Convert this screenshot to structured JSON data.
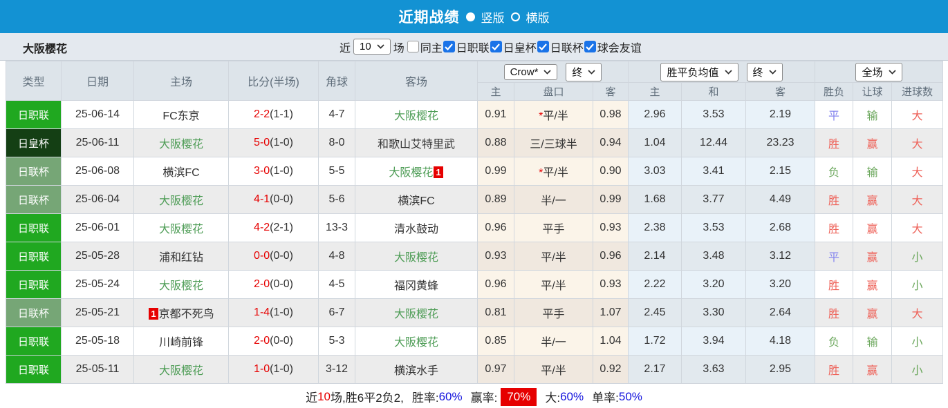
{
  "colors": {
    "titlebar_bg": "#1392d3",
    "league_colors": {
      "日职联": "#20a820",
      "日皇杯": "#143f14",
      "日联杯": "#76a676"
    },
    "self_team_green": "#4d9c55",
    "score_red": "#e60000",
    "checkbox_blue": "#1a73e8",
    "result_colors": {
      "red": "#ee6259",
      "blue": "#8585ee",
      "green": "#6ba75c"
    },
    "summary_value_blue": "#1414dd",
    "summary_badge_bg": "#e60000"
  },
  "titlebar": {
    "title": "近期战绩",
    "radio_options": [
      {
        "label": "竖版",
        "selected": true
      },
      {
        "label": "横版",
        "selected": false
      }
    ]
  },
  "filterbar": {
    "team": "大阪樱花",
    "near_label": "近",
    "count_select": "10",
    "games_label": "场",
    "checkboxes": [
      {
        "label": "同主",
        "checked": false
      },
      {
        "label": "日职联",
        "checked": true
      },
      {
        "label": "日皇杯",
        "checked": true
      },
      {
        "label": "日联杯",
        "checked": true
      },
      {
        "label": "球会友谊",
        "checked": true
      }
    ]
  },
  "table": {
    "static_headers": [
      "类型",
      "日期",
      "主场",
      "比分(半场)",
      "角球",
      "客场"
    ],
    "selects": {
      "bookmaker": "Crow*",
      "ah_time": "终",
      "odds_type": "胜平负均值",
      "eu_time": "终",
      "scope": "全场"
    },
    "sub_headers": [
      "主",
      "盘口",
      "客",
      "主",
      "和",
      "客",
      "胜负",
      "让球",
      "进球数"
    ],
    "rows": [
      {
        "type": "日职联",
        "date": "25-06-14",
        "home": {
          "name": "FC东京",
          "self": false
        },
        "score": "2-2",
        "half": "(1-1)",
        "corners": "4-7",
        "away": {
          "name": "大阪樱花",
          "self": true
        },
        "ah": [
          "0.91",
          "*平/半",
          "0.98"
        ],
        "eu": [
          "2.96",
          "3.53",
          "2.19"
        ],
        "res": [
          [
            "平",
            "blue"
          ],
          [
            "输",
            "green"
          ],
          [
            "大",
            "red"
          ]
        ]
      },
      {
        "type": "日皇杯",
        "date": "25-06-11",
        "home": {
          "name": "大阪樱花",
          "self": true
        },
        "score": "5-0",
        "half": "(1-0)",
        "corners": "8-0",
        "away": {
          "name": "和歌山艾特里武",
          "self": false
        },
        "ah": [
          "0.88",
          "三/三球半",
          "0.94"
        ],
        "eu": [
          "1.04",
          "12.44",
          "23.23"
        ],
        "res": [
          [
            "胜",
            "red"
          ],
          [
            "赢",
            "red"
          ],
          [
            "大",
            "red"
          ]
        ]
      },
      {
        "type": "日联杯",
        "date": "25-06-08",
        "home": {
          "name": "横滨FC",
          "self": false
        },
        "score": "3-0",
        "half": "(1-0)",
        "corners": "5-5",
        "away": {
          "name": "大阪樱花",
          "self": true,
          "badge": "1",
          "badge_pos": "after"
        },
        "ah": [
          "0.99",
          "*平/半",
          "0.90"
        ],
        "eu": [
          "3.03",
          "3.41",
          "2.15"
        ],
        "res": [
          [
            "负",
            "green"
          ],
          [
            "输",
            "green"
          ],
          [
            "大",
            "red"
          ]
        ]
      },
      {
        "type": "日联杯",
        "date": "25-06-04",
        "home": {
          "name": "大阪樱花",
          "self": true
        },
        "score": "4-1",
        "half": "(0-0)",
        "corners": "5-6",
        "away": {
          "name": "横滨FC",
          "self": false
        },
        "ah": [
          "0.89",
          "半/一",
          "0.99"
        ],
        "eu": [
          "1.68",
          "3.77",
          "4.49"
        ],
        "res": [
          [
            "胜",
            "red"
          ],
          [
            "赢",
            "red"
          ],
          [
            "大",
            "red"
          ]
        ]
      },
      {
        "type": "日职联",
        "date": "25-06-01",
        "home": {
          "name": "大阪樱花",
          "self": true
        },
        "score": "4-2",
        "half": "(2-1)",
        "corners": "13-3",
        "away": {
          "name": "清水鼓动",
          "self": false
        },
        "ah": [
          "0.96",
          "平手",
          "0.93"
        ],
        "eu": [
          "2.38",
          "3.53",
          "2.68"
        ],
        "res": [
          [
            "胜",
            "red"
          ],
          [
            "赢",
            "red"
          ],
          [
            "大",
            "red"
          ]
        ]
      },
      {
        "type": "日职联",
        "date": "25-05-28",
        "home": {
          "name": "浦和红钻",
          "self": false
        },
        "score": "0-0",
        "half": "(0-0)",
        "corners": "4-8",
        "away": {
          "name": "大阪樱花",
          "self": true
        },
        "ah": [
          "0.93",
          "平/半",
          "0.96"
        ],
        "eu": [
          "2.14",
          "3.48",
          "3.12"
        ],
        "res": [
          [
            "平",
            "blue"
          ],
          [
            "赢",
            "red"
          ],
          [
            "小",
            "green"
          ]
        ]
      },
      {
        "type": "日职联",
        "date": "25-05-24",
        "home": {
          "name": "大阪樱花",
          "self": true
        },
        "score": "2-0",
        "half": "(0-0)",
        "corners": "4-5",
        "away": {
          "name": "福冈黄蜂",
          "self": false
        },
        "ah": [
          "0.96",
          "平/半",
          "0.93"
        ],
        "eu": [
          "2.22",
          "3.20",
          "3.20"
        ],
        "res": [
          [
            "胜",
            "red"
          ],
          [
            "赢",
            "red"
          ],
          [
            "小",
            "green"
          ]
        ]
      },
      {
        "type": "日联杯",
        "date": "25-05-21",
        "home": {
          "name": "京都不死鸟",
          "self": false,
          "badge": "1",
          "badge_pos": "before"
        },
        "score": "1-4",
        "half": "(1-0)",
        "corners": "6-7",
        "away": {
          "name": "大阪樱花",
          "self": true
        },
        "ah": [
          "0.81",
          "平手",
          "1.07"
        ],
        "eu": [
          "2.45",
          "3.30",
          "2.64"
        ],
        "res": [
          [
            "胜",
            "red"
          ],
          [
            "赢",
            "red"
          ],
          [
            "大",
            "red"
          ]
        ]
      },
      {
        "type": "日职联",
        "date": "25-05-18",
        "home": {
          "name": "川崎前锋",
          "self": false
        },
        "score": "2-0",
        "half": "(0-0)",
        "corners": "5-3",
        "away": {
          "name": "大阪樱花",
          "self": true
        },
        "ah": [
          "0.85",
          "半/一",
          "1.04"
        ],
        "eu": [
          "1.72",
          "3.94",
          "4.18"
        ],
        "res": [
          [
            "负",
            "green"
          ],
          [
            "输",
            "green"
          ],
          [
            "小",
            "green"
          ]
        ]
      },
      {
        "type": "日职联",
        "date": "25-05-11",
        "home": {
          "name": "大阪樱花",
          "self": true
        },
        "score": "1-0",
        "half": "(1-0)",
        "corners": "3-12",
        "away": {
          "name": "横滨水手",
          "self": false
        },
        "ah": [
          "0.97",
          "平/半",
          "0.92"
        ],
        "eu": [
          "2.17",
          "3.63",
          "2.95"
        ],
        "res": [
          [
            "胜",
            "red"
          ],
          [
            "赢",
            "red"
          ],
          [
            "小",
            "green"
          ]
        ]
      }
    ]
  },
  "summary": {
    "seg_near": "近",
    "seg_count": "10",
    "seg_record": "场,胜6平2负2,",
    "seg_winrate_label": "胜率:",
    "seg_winrate_value": "60%",
    "seg_handicap_label": "赢率:",
    "seg_handicap_value": "70%",
    "seg_big_label": "大:",
    "seg_big_value": "60%",
    "seg_single_label": "单率:",
    "seg_single_value": "50%"
  }
}
